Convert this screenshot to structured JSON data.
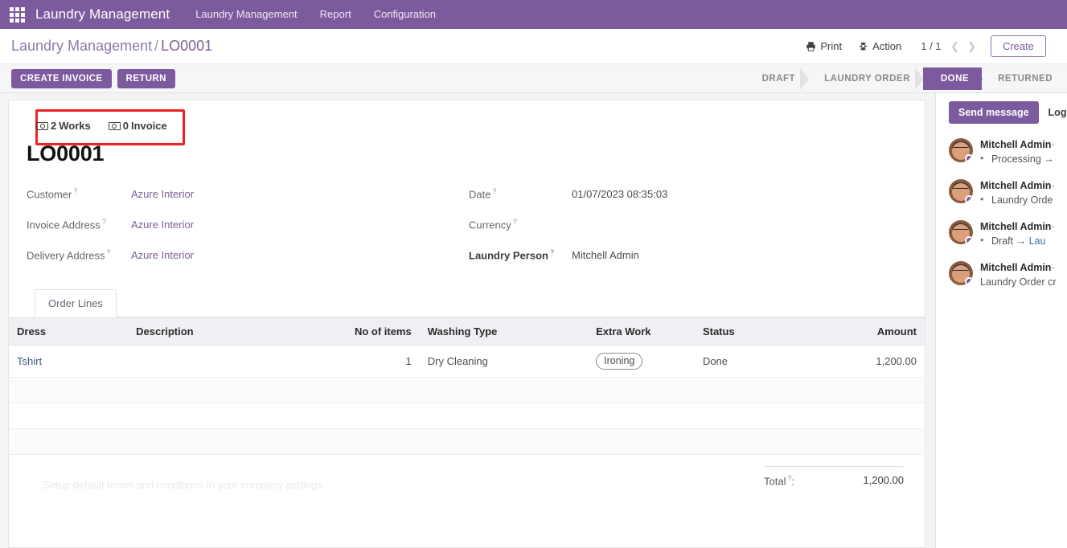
{
  "navbar": {
    "apps_icon": "grid-apps-icon",
    "brand": "Laundry Management",
    "menus": [
      {
        "label": "Laundry Management"
      },
      {
        "label": "Report"
      },
      {
        "label": "Configuration"
      }
    ]
  },
  "control_panel": {
    "breadcrumb_root": "Laundry Management",
    "breadcrumb_sep": "/",
    "breadcrumb_current": "LO0001",
    "print_label": "Print",
    "print_icon": "printer-icon",
    "action_label": "Action",
    "action_icon": "gear-icon",
    "pager": "1 / 1",
    "prev_icon": "chevron-left-icon",
    "next_icon": "chevron-right-icon",
    "create_label": "Create"
  },
  "statusbar": {
    "buttons": [
      {
        "label": "CREATE INVOICE"
      },
      {
        "label": "RETURN"
      }
    ],
    "stages": [
      {
        "label": "DRAFT",
        "active": false
      },
      {
        "label": "LAUNDRY ORDER",
        "active": false
      },
      {
        "label": "DONE",
        "active": true
      },
      {
        "label": "RETURNED",
        "active": false
      }
    ]
  },
  "smart_buttons": [
    {
      "icon": "money-bill-icon",
      "count": "2",
      "label": "Works"
    },
    {
      "icon": "money-bill-icon",
      "count": "0",
      "label": "Invoice"
    }
  ],
  "record": {
    "title": "LO0001",
    "left_fields": [
      {
        "label": "Customer",
        "value": "Azure Interior",
        "link": true
      },
      {
        "label": "Invoice Address",
        "value": "Azure Interior",
        "link": true
      },
      {
        "label": "Delivery Address",
        "value": "Azure Interior",
        "link": true
      }
    ],
    "right_fields": [
      {
        "label": "Date",
        "value": "01/07/2023 08:35:03",
        "link": false,
        "bold": false
      },
      {
        "label": "Currency",
        "value": "",
        "link": false,
        "bold": false
      },
      {
        "label": "Laundry Person",
        "value": "Mitchell Admin",
        "link": false,
        "bold": true
      }
    ]
  },
  "notebook": {
    "tabs": [
      {
        "label": "Order Lines",
        "active": true
      }
    ]
  },
  "order_lines": {
    "columns": [
      {
        "label": "Dress",
        "align": "left"
      },
      {
        "label": "Description",
        "align": "left"
      },
      {
        "label": "No of items",
        "align": "right"
      },
      {
        "label": "Washing Type",
        "align": "left"
      },
      {
        "label": "Extra Work",
        "align": "left"
      },
      {
        "label": "Status",
        "align": "left"
      },
      {
        "label": "Amount",
        "align": "right"
      }
    ],
    "rows": [
      {
        "dress": "Tshirt",
        "description": "",
        "no_of_items": "1",
        "washing_type": "Dry Cleaning",
        "extra_work": "Ironing",
        "status": "Done",
        "amount": "1,200.00"
      }
    ],
    "empty_row_count": 3
  },
  "footer": {
    "terms_placeholder": "Setup default terms and conditions in your company settings.",
    "total_label": "Total",
    "total_colon": ":",
    "total_value": "1,200.00"
  },
  "chatter": {
    "send_message_label": "Send message",
    "log_note_label": "Log",
    "messages": [
      {
        "author": "Mitchell Admin",
        "meta": "- ",
        "tracking": true,
        "bullet": true,
        "text": "Processing",
        "arrow": "→",
        "to": ""
      },
      {
        "author": "Mitchell Admin",
        "meta": "- ",
        "tracking": true,
        "bullet": true,
        "text": "Laundry Orde",
        "arrow": "",
        "to": ""
      },
      {
        "author": "Mitchell Admin",
        "meta": "- ",
        "tracking": true,
        "bullet": true,
        "text": "Draft",
        "arrow": "→",
        "to": "Lau"
      },
      {
        "author": "Mitchell Admin",
        "meta": "- ",
        "tracking": false,
        "bullet": false,
        "text": "Laundry Order cr",
        "arrow": "",
        "to": ""
      }
    ]
  },
  "colors": {
    "brand_purple": "#7c5a9e",
    "link_purple": "#7b5f96",
    "annotation_red": "#ee2222",
    "statusbar_bg": "#f6f6f6",
    "sheet_bg": "#f4f4f4"
  }
}
